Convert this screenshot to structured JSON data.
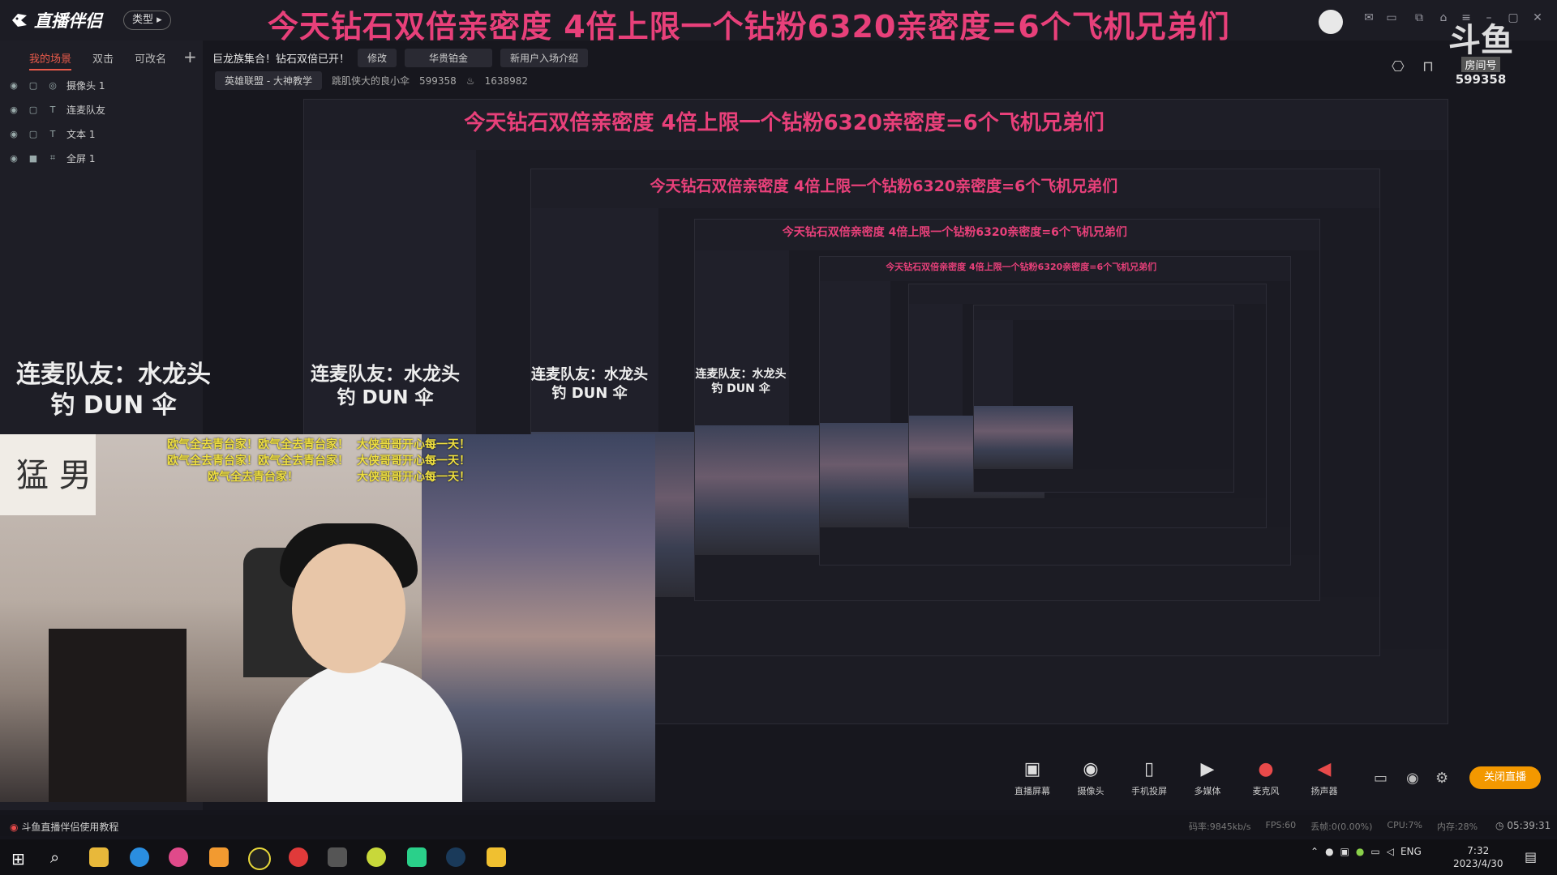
{
  "app": {
    "logo_text": "直播伴侣",
    "type_chip": "类型 ▸"
  },
  "banner": "今天钻石双倍亲密度 4倍上限一个钻粉6320亲密度=6个飞机兄弟们",
  "scene_tabs": [
    {
      "label": "我的场景",
      "active": true
    },
    {
      "label": "双击",
      "active": false
    },
    {
      "label": "可改名",
      "active": false
    }
  ],
  "layers": [
    {
      "icon": "camera-icon",
      "label": "摄像头 1"
    },
    {
      "icon": "text-icon",
      "label": "连麦队友"
    },
    {
      "icon": "text-icon",
      "label": "文本 1"
    },
    {
      "icon": "fullscreen-icon",
      "label": "全屏 1"
    }
  ],
  "row2": {
    "announce": "巨龙族集合！钻石双倍已开！",
    "edit": "修改",
    "tag1": "华贵铂金",
    "tag2": "新用户入场介绍"
  },
  "row3": {
    "category": "英雄联盟 - 大神教学",
    "streamer": "跳肌侠大的良小伞",
    "id1": "599358",
    "heat": "1638982"
  },
  "teammate_line1": "连麦队友：水龙头",
  "teammate_line2": "钓 DUN 伞",
  "watermark": {
    "brand": "斗鱼",
    "room_label": "房间号",
    "room": "599358"
  },
  "danmaku": {
    "left": [
      "欧气全去青台家！欧气全去青台家！",
      "欧气全去青台家！欧气全去青台家！",
      "欧气全去青台家！"
    ],
    "right": [
      "大侠哥哥开心每一天！",
      "大侠哥哥开心每一天！",
      "大侠哥哥开心每一天！"
    ]
  },
  "webcam": {
    "calligraphy": "猛 男"
  },
  "tools": [
    {
      "icon": "screen-icon",
      "glyph": "▣",
      "label": "直播屏幕"
    },
    {
      "icon": "camera-icon",
      "glyph": "◉",
      "label": "摄像头"
    },
    {
      "icon": "phone-icon",
      "glyph": "▯",
      "label": "手机投屏"
    },
    {
      "icon": "media-icon",
      "glyph": "▶",
      "label": "多媒体"
    },
    {
      "icon": "mic-icon",
      "glyph": "●",
      "label": "麦克风"
    },
    {
      "icon": "speaker-icon",
      "glyph": "◀",
      "label": "扬声器"
    }
  ],
  "end_live": "关闭直播",
  "status": {
    "tutorial": "斗鱼直播伴侣使用教程",
    "bitrate": "码率:9845kb/s",
    "fps": "FPS:60",
    "drop": "丢帧:0(0.00%)",
    "cpu": "CPU:7%",
    "mem": "内存:28%",
    "duration": "05:39:31"
  },
  "taskbar": {
    "lang": "ENG",
    "time": "7:32",
    "date": "2023/4/30"
  },
  "colors": {
    "banner": "#e8407a",
    "accent": "#f39800",
    "active_tab": "#e85a4a"
  }
}
